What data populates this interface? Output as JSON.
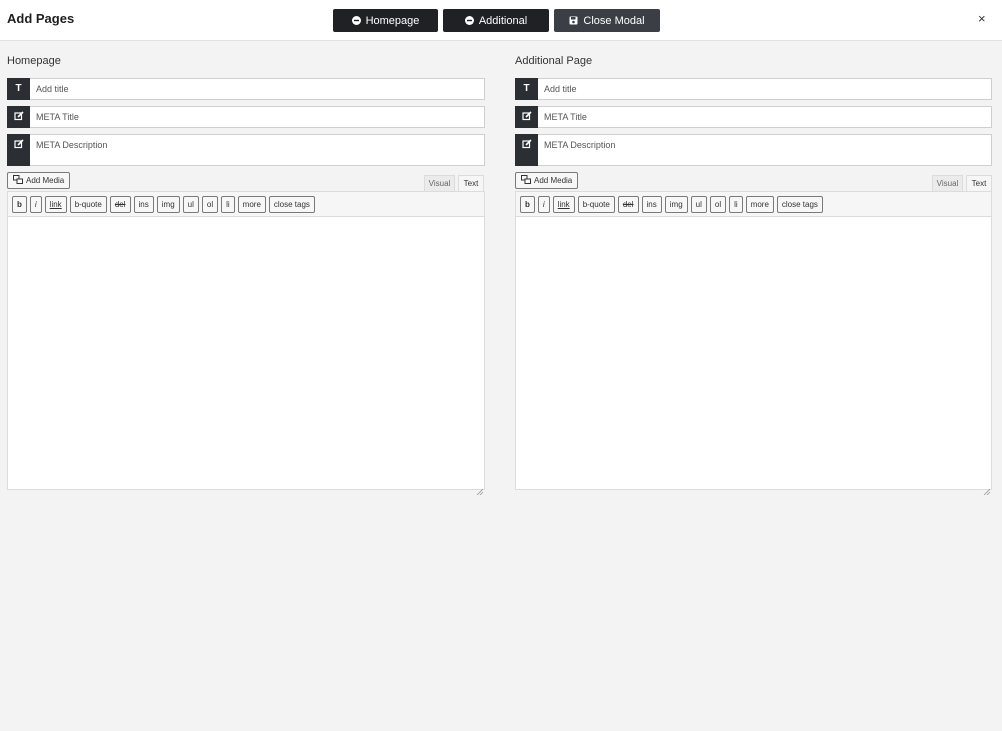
{
  "header": {
    "title": "Add Pages",
    "buttons": {
      "homepage": "Homepage",
      "additional": "Additional",
      "close_modal": "Close Modal"
    },
    "close_symbol": "×"
  },
  "columns": [
    {
      "title": "Homepage",
      "title_placeholder": "Add title",
      "meta_title_placeholder": "META Title",
      "meta_description_placeholder": "META Description",
      "add_media": "Add Media",
      "tab_visual": "Visual",
      "tab_text": "Text",
      "quicktags": [
        "b",
        "i",
        "link",
        "b-quote",
        "del",
        "ins",
        "img",
        "ul",
        "ol",
        "li",
        "more",
        "close tags"
      ]
    },
    {
      "title": "Additional Page",
      "title_placeholder": "Add title",
      "meta_title_placeholder": "META Title",
      "meta_description_placeholder": "META Description",
      "add_media": "Add Media",
      "tab_visual": "Visual",
      "tab_text": "Text",
      "quicktags": [
        "b",
        "i",
        "link",
        "b-quote",
        "del",
        "ins",
        "img",
        "ul",
        "ol",
        "li",
        "more",
        "close tags"
      ]
    }
  ],
  "icons": {
    "title_field": "T",
    "edit_field": "edit-icon",
    "minus_circle": "minus-circle-icon",
    "save": "save-icon",
    "add_media": "media-icon"
  },
  "colors": {
    "dark_button": "#1f2125",
    "addon": "#2b2e33",
    "background": "#f3f3f3"
  }
}
